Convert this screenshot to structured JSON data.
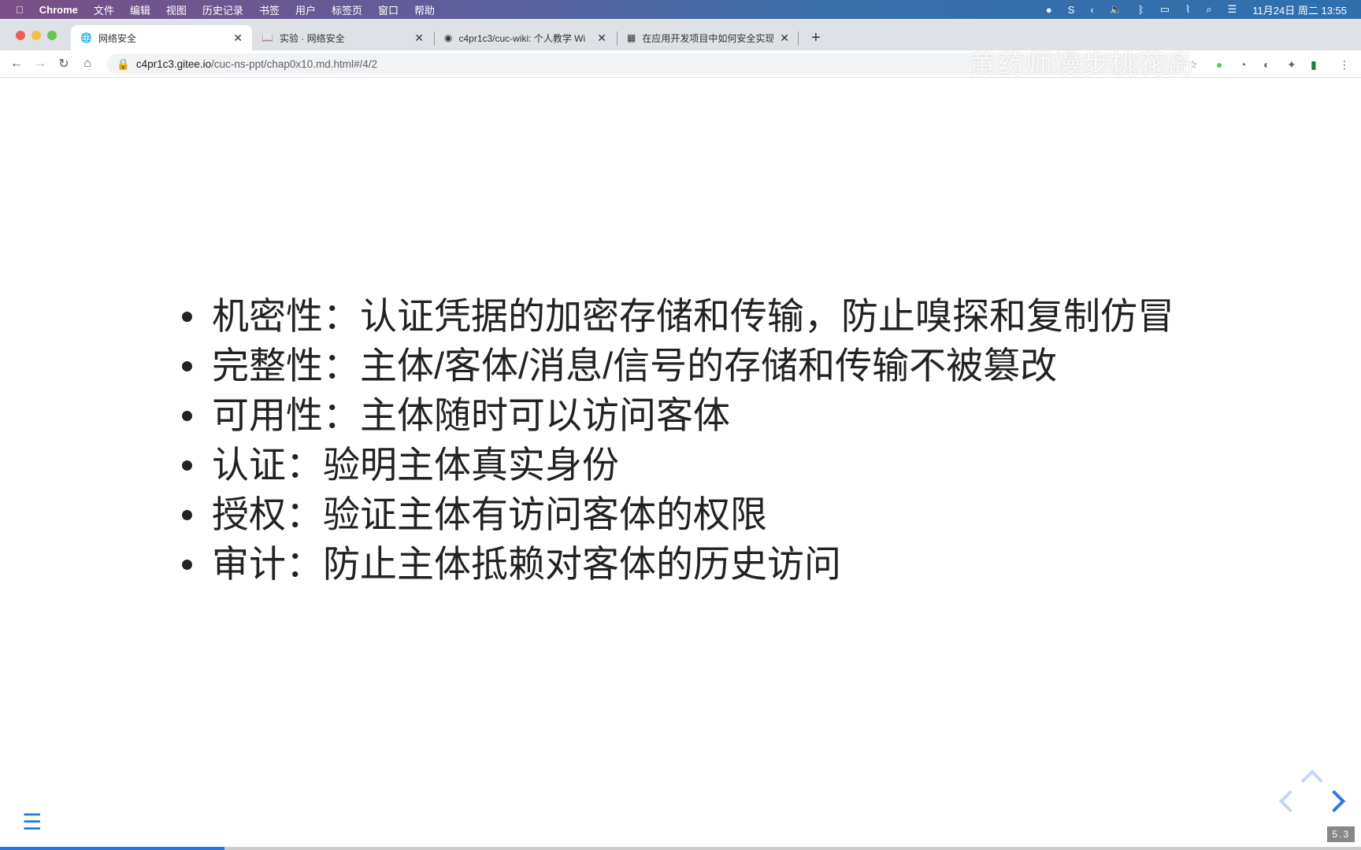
{
  "menubar": {
    "app": "Chrome",
    "items": [
      "文件",
      "编辑",
      "视图",
      "历史记录",
      "书签",
      "用户",
      "标签页",
      "窗口",
      "帮助"
    ],
    "clock": "11月24日 周二 13:55"
  },
  "tabs": [
    {
      "title": "网络安全",
      "active": true
    },
    {
      "title": "实验 · 网络安全"
    },
    {
      "title": "c4pr1c3/cuc-wiki: 个人教学 Wi"
    },
    {
      "title": "在应用开发项目中如何安全实现"
    }
  ],
  "address": {
    "host": "c4pr1c3.gitee.io",
    "path": "/cuc-ns-ppt/chap0x10.md.html#/4/2"
  },
  "watermark": "黄药师漫步桃花岛",
  "slide": {
    "bullets": [
      "机密性：认证凭据的加密存储和传输，防止嗅探和复制仿冒",
      "完整性：主体/客体/消息/信号的存储和传输不被篡改",
      "可用性：主体随时可以访问客体",
      "认证：验明主体真实身份",
      "授权：验证主体有访问客体的权限",
      "审计：防止主体抵赖对客体的历史访问"
    ]
  },
  "slide_number": "5.3",
  "progress_percent": 16.5,
  "colors": {
    "accent": "#2a76dd"
  }
}
